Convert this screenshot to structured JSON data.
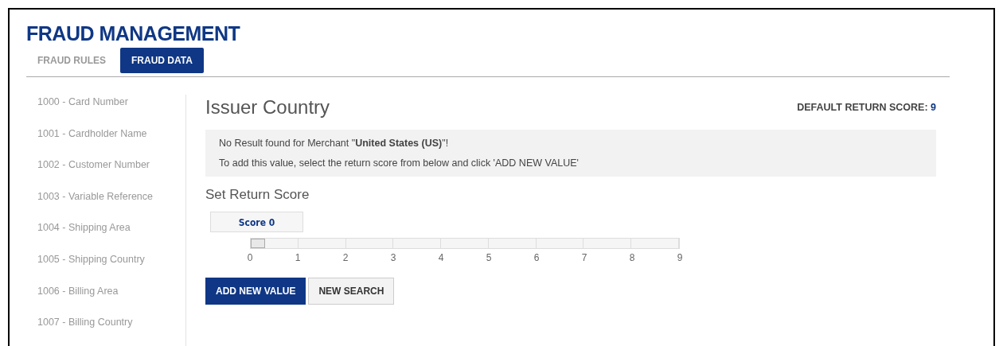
{
  "title": "FRAUD MANAGEMENT",
  "tabs": [
    {
      "label": "FRAUD RULES",
      "selected": false
    },
    {
      "label": "FRAUD DATA",
      "selected": true
    }
  ],
  "sidebar": {
    "items": [
      "1000 - Card Number",
      "1001 - Cardholder Name",
      "1002 - Customer Number",
      "1003 - Variable Reference",
      "1004 - Shipping Area",
      "1005 - Shipping Country",
      "1006 - Billing Area",
      "1007 - Billing Country"
    ]
  },
  "heading": "Issuer Country",
  "default_score": {
    "label": "DEFAULT RETURN SCORE:",
    "value": "9"
  },
  "notice": {
    "lines": [
      "No Result found for Merchant \"**United States (US)**\"!",
      "To add this value, select the return score from below and click 'ADD NEW VALUE'"
    ]
  },
  "set_score_label": "Set Return Score",
  "slider": {
    "tooltip": "Score 0",
    "level": 0,
    "ticks": [
      "0",
      "1",
      "2",
      "3",
      "4",
      "5",
      "6",
      "7",
      "8",
      "9"
    ]
  },
  "buttons": [
    {
      "label": "ADD NEW VALUE",
      "kind": "primary"
    },
    {
      "label": "NEW SEARCH",
      "kind": "secondary"
    }
  ]
}
